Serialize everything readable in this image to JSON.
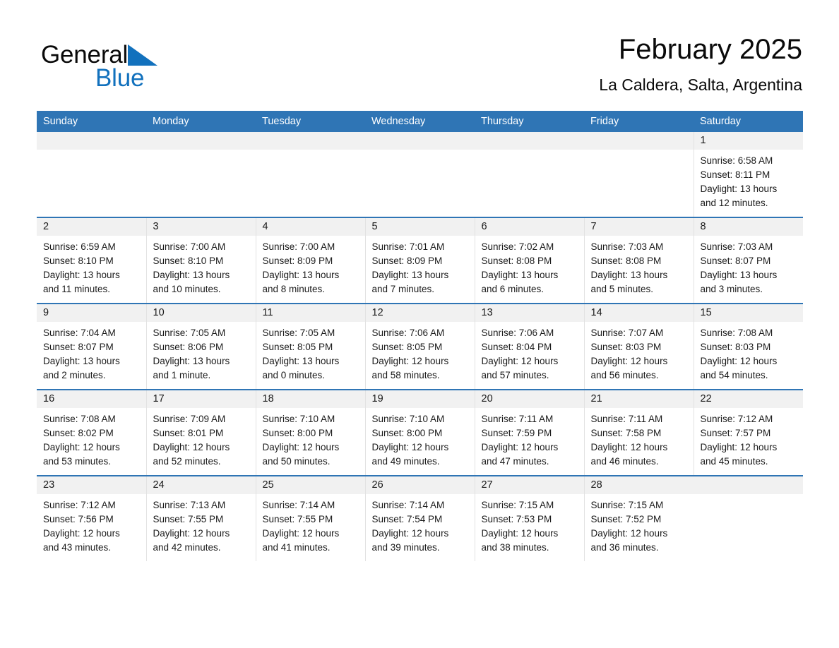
{
  "brand": {
    "name_part1": "General",
    "name_part2": "Blue",
    "triangle_color": "#1271bd",
    "text_color": "#0a0a0a"
  },
  "header": {
    "title": "February 2025",
    "subtitle": "La Caldera, Salta, Argentina"
  },
  "theme": {
    "header_blue": "#2f75b5",
    "date_strip_gray": "#f1f1f1",
    "row_border_blue": "#2f75b5",
    "text_black": "#1a1a1a"
  },
  "weekday_headers": [
    "Sunday",
    "Monday",
    "Tuesday",
    "Wednesday",
    "Thursday",
    "Friday",
    "Saturday"
  ],
  "weeks": [
    [
      {
        "date": "",
        "sunrise": "",
        "sunset": "",
        "daylight_line1": "",
        "daylight_line2": ""
      },
      {
        "date": "",
        "sunrise": "",
        "sunset": "",
        "daylight_line1": "",
        "daylight_line2": ""
      },
      {
        "date": "",
        "sunrise": "",
        "sunset": "",
        "daylight_line1": "",
        "daylight_line2": ""
      },
      {
        "date": "",
        "sunrise": "",
        "sunset": "",
        "daylight_line1": "",
        "daylight_line2": ""
      },
      {
        "date": "",
        "sunrise": "",
        "sunset": "",
        "daylight_line1": "",
        "daylight_line2": ""
      },
      {
        "date": "",
        "sunrise": "",
        "sunset": "",
        "daylight_line1": "",
        "daylight_line2": ""
      },
      {
        "date": "1",
        "sunrise": "Sunrise: 6:58 AM",
        "sunset": "Sunset: 8:11 PM",
        "daylight_line1": "Daylight: 13 hours",
        "daylight_line2": "and 12 minutes."
      }
    ],
    [
      {
        "date": "2",
        "sunrise": "Sunrise: 6:59 AM",
        "sunset": "Sunset: 8:10 PM",
        "daylight_line1": "Daylight: 13 hours",
        "daylight_line2": "and 11 minutes."
      },
      {
        "date": "3",
        "sunrise": "Sunrise: 7:00 AM",
        "sunset": "Sunset: 8:10 PM",
        "daylight_line1": "Daylight: 13 hours",
        "daylight_line2": "and 10 minutes."
      },
      {
        "date": "4",
        "sunrise": "Sunrise: 7:00 AM",
        "sunset": "Sunset: 8:09 PM",
        "daylight_line1": "Daylight: 13 hours",
        "daylight_line2": "and 8 minutes."
      },
      {
        "date": "5",
        "sunrise": "Sunrise: 7:01 AM",
        "sunset": "Sunset: 8:09 PM",
        "daylight_line1": "Daylight: 13 hours",
        "daylight_line2": "and 7 minutes."
      },
      {
        "date": "6",
        "sunrise": "Sunrise: 7:02 AM",
        "sunset": "Sunset: 8:08 PM",
        "daylight_line1": "Daylight: 13 hours",
        "daylight_line2": "and 6 minutes."
      },
      {
        "date": "7",
        "sunrise": "Sunrise: 7:03 AM",
        "sunset": "Sunset: 8:08 PM",
        "daylight_line1": "Daylight: 13 hours",
        "daylight_line2": "and 5 minutes."
      },
      {
        "date": "8",
        "sunrise": "Sunrise: 7:03 AM",
        "sunset": "Sunset: 8:07 PM",
        "daylight_line1": "Daylight: 13 hours",
        "daylight_line2": "and 3 minutes."
      }
    ],
    [
      {
        "date": "9",
        "sunrise": "Sunrise: 7:04 AM",
        "sunset": "Sunset: 8:07 PM",
        "daylight_line1": "Daylight: 13 hours",
        "daylight_line2": "and 2 minutes."
      },
      {
        "date": "10",
        "sunrise": "Sunrise: 7:05 AM",
        "sunset": "Sunset: 8:06 PM",
        "daylight_line1": "Daylight: 13 hours",
        "daylight_line2": "and 1 minute."
      },
      {
        "date": "11",
        "sunrise": "Sunrise: 7:05 AM",
        "sunset": "Sunset: 8:05 PM",
        "daylight_line1": "Daylight: 13 hours",
        "daylight_line2": "and 0 minutes."
      },
      {
        "date": "12",
        "sunrise": "Sunrise: 7:06 AM",
        "sunset": "Sunset: 8:05 PM",
        "daylight_line1": "Daylight: 12 hours",
        "daylight_line2": "and 58 minutes."
      },
      {
        "date": "13",
        "sunrise": "Sunrise: 7:06 AM",
        "sunset": "Sunset: 8:04 PM",
        "daylight_line1": "Daylight: 12 hours",
        "daylight_line2": "and 57 minutes."
      },
      {
        "date": "14",
        "sunrise": "Sunrise: 7:07 AM",
        "sunset": "Sunset: 8:03 PM",
        "daylight_line1": "Daylight: 12 hours",
        "daylight_line2": "and 56 minutes."
      },
      {
        "date": "15",
        "sunrise": "Sunrise: 7:08 AM",
        "sunset": "Sunset: 8:03 PM",
        "daylight_line1": "Daylight: 12 hours",
        "daylight_line2": "and 54 minutes."
      }
    ],
    [
      {
        "date": "16",
        "sunrise": "Sunrise: 7:08 AM",
        "sunset": "Sunset: 8:02 PM",
        "daylight_line1": "Daylight: 12 hours",
        "daylight_line2": "and 53 minutes."
      },
      {
        "date": "17",
        "sunrise": "Sunrise: 7:09 AM",
        "sunset": "Sunset: 8:01 PM",
        "daylight_line1": "Daylight: 12 hours",
        "daylight_line2": "and 52 minutes."
      },
      {
        "date": "18",
        "sunrise": "Sunrise: 7:10 AM",
        "sunset": "Sunset: 8:00 PM",
        "daylight_line1": "Daylight: 12 hours",
        "daylight_line2": "and 50 minutes."
      },
      {
        "date": "19",
        "sunrise": "Sunrise: 7:10 AM",
        "sunset": "Sunset: 8:00 PM",
        "daylight_line1": "Daylight: 12 hours",
        "daylight_line2": "and 49 minutes."
      },
      {
        "date": "20",
        "sunrise": "Sunrise: 7:11 AM",
        "sunset": "Sunset: 7:59 PM",
        "daylight_line1": "Daylight: 12 hours",
        "daylight_line2": "and 47 minutes."
      },
      {
        "date": "21",
        "sunrise": "Sunrise: 7:11 AM",
        "sunset": "Sunset: 7:58 PM",
        "daylight_line1": "Daylight: 12 hours",
        "daylight_line2": "and 46 minutes."
      },
      {
        "date": "22",
        "sunrise": "Sunrise: 7:12 AM",
        "sunset": "Sunset: 7:57 PM",
        "daylight_line1": "Daylight: 12 hours",
        "daylight_line2": "and 45 minutes."
      }
    ],
    [
      {
        "date": "23",
        "sunrise": "Sunrise: 7:12 AM",
        "sunset": "Sunset: 7:56 PM",
        "daylight_line1": "Daylight: 12 hours",
        "daylight_line2": "and 43 minutes."
      },
      {
        "date": "24",
        "sunrise": "Sunrise: 7:13 AM",
        "sunset": "Sunset: 7:55 PM",
        "daylight_line1": "Daylight: 12 hours",
        "daylight_line2": "and 42 minutes."
      },
      {
        "date": "25",
        "sunrise": "Sunrise: 7:14 AM",
        "sunset": "Sunset: 7:55 PM",
        "daylight_line1": "Daylight: 12 hours",
        "daylight_line2": "and 41 minutes."
      },
      {
        "date": "26",
        "sunrise": "Sunrise: 7:14 AM",
        "sunset": "Sunset: 7:54 PM",
        "daylight_line1": "Daylight: 12 hours",
        "daylight_line2": "and 39 minutes."
      },
      {
        "date": "27",
        "sunrise": "Sunrise: 7:15 AM",
        "sunset": "Sunset: 7:53 PM",
        "daylight_line1": "Daylight: 12 hours",
        "daylight_line2": "and 38 minutes."
      },
      {
        "date": "28",
        "sunrise": "Sunrise: 7:15 AM",
        "sunset": "Sunset: 7:52 PM",
        "daylight_line1": "Daylight: 12 hours",
        "daylight_line2": "and 36 minutes."
      },
      {
        "date": "",
        "sunrise": "",
        "sunset": "",
        "daylight_line1": "",
        "daylight_line2": ""
      }
    ]
  ]
}
